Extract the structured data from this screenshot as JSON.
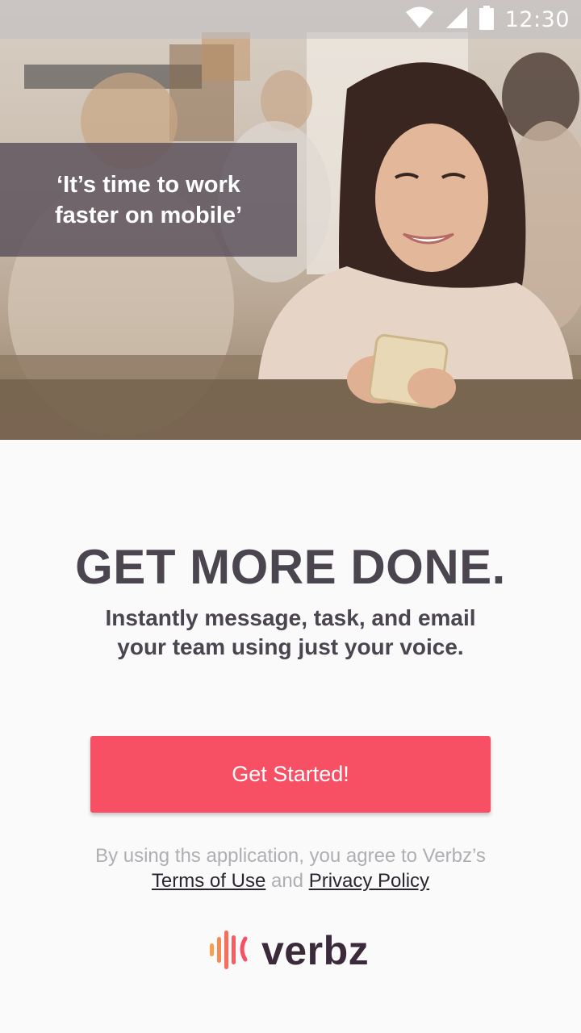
{
  "status_bar": {
    "time": "12:30",
    "icons": [
      "wifi-icon",
      "signal-icon",
      "battery-icon"
    ]
  },
  "hero": {
    "quote_line1": "‘It’s time to work",
    "quote_line2": "faster on mobile’"
  },
  "main": {
    "headline": "GET MORE DONE.",
    "subheadline_line1": "Instantly message, task, and email",
    "subheadline_line2": "your team using just your voice.",
    "cta_label": "Get Started!"
  },
  "legal": {
    "prefix": "By using ths application, you agree to Verbz’s",
    "terms_label": "Terms of Use",
    "conjunction": "and",
    "privacy_label": "Privacy Policy"
  },
  "brand": {
    "logo_text": "verbz",
    "accent_color": "#f74f63",
    "text_color": "#4b4550"
  }
}
